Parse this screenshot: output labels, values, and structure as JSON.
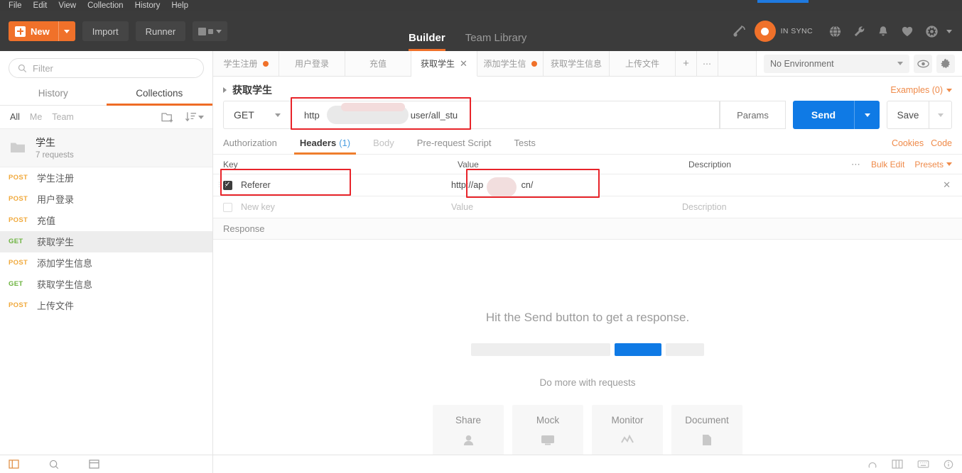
{
  "menubar": {
    "items": [
      "File",
      "Edit",
      "View",
      "Collection",
      "History",
      "Help"
    ]
  },
  "topnav": {
    "new_label": "New",
    "import_label": "Import",
    "runner_label": "Runner",
    "tabs": [
      {
        "label": "Builder",
        "active": true
      },
      {
        "label": "Team Library",
        "active": false
      }
    ],
    "sync_label": "IN SYNC",
    "icons": [
      "broadcast-icon",
      "sync-status-icon",
      "globe-icon",
      "wrench-icon",
      "bell-icon",
      "heart-icon",
      "gear-icon",
      "chevron-down-icon"
    ]
  },
  "sidebar": {
    "filter_placeholder": "Filter",
    "tabs": [
      {
        "label": "History",
        "active": false
      },
      {
        "label": "Collections",
        "active": true
      }
    ],
    "scope_filters": [
      {
        "label": "All",
        "active": true
      },
      {
        "label": "Me",
        "active": false
      },
      {
        "label": "Team",
        "active": false
      }
    ],
    "collection": {
      "name": "学生",
      "count_label": "7 requests"
    },
    "requests": [
      {
        "method": "POST",
        "name": "学生注册",
        "selected": false
      },
      {
        "method": "POST",
        "name": "用户登录",
        "selected": false
      },
      {
        "method": "POST",
        "name": "充值",
        "selected": false
      },
      {
        "method": "GET",
        "name": "获取学生",
        "selected": true
      },
      {
        "method": "POST",
        "name": "添加学生信息",
        "selected": false
      },
      {
        "method": "GET",
        "name": "获取学生信息",
        "selected": false
      },
      {
        "method": "POST",
        "name": "上传文件",
        "selected": false
      }
    ]
  },
  "main": {
    "tabs": [
      {
        "label": "学生注册",
        "dirty": true,
        "active": false,
        "closable": false
      },
      {
        "label": "用户登录",
        "dirty": false,
        "active": false,
        "closable": false
      },
      {
        "label": "充值",
        "dirty": false,
        "active": false,
        "closable": false
      },
      {
        "label": "获取学生",
        "dirty": false,
        "active": true,
        "closable": true
      },
      {
        "label": "添加学生信",
        "dirty": true,
        "active": false,
        "closable": false
      },
      {
        "label": "获取学生信息",
        "dirty": false,
        "active": false,
        "closable": false
      },
      {
        "label": "上传文件",
        "dirty": false,
        "active": false,
        "closable": false
      }
    ],
    "tab_add_label": "+",
    "tab_more_label": "•••",
    "environment": {
      "selected": "No Environment",
      "eye_icon": "eye-icon",
      "gear_icon": "gear-icon"
    },
    "request_title": "获取学生",
    "examples_label": "Examples (0)",
    "url_bar": {
      "method": "GET",
      "url_prefix": "http",
      "url_suffix": "user/all_stu",
      "params_label": "Params",
      "send_label": "Send",
      "save_label": "Save"
    },
    "request_tabs": [
      {
        "label": "Authorization",
        "active": false,
        "muted": false
      },
      {
        "label": "Headers",
        "count": "(1)",
        "active": true,
        "muted": false
      },
      {
        "label": "Body",
        "active": false,
        "muted": true
      },
      {
        "label": "Pre-request Script",
        "active": false,
        "muted": false
      },
      {
        "label": "Tests",
        "active": false,
        "muted": false
      }
    ],
    "cookies_label": "Cookies",
    "code_label": "Code",
    "headers_table": {
      "columns": [
        "Key",
        "Value",
        "Description"
      ],
      "bulk_edit_label": "Bulk Edit",
      "presets_label": "Presets",
      "rows": [
        {
          "checked": true,
          "key": "Referer",
          "value_prefix": "http://ap",
          "value_suffix": "cn/",
          "description": ""
        }
      ],
      "new_row": {
        "key_placeholder": "New key",
        "value_placeholder": "Value",
        "description_placeholder": "Description"
      }
    },
    "response": {
      "header_label": "Response",
      "empty_title": "Hit the Send button to get a response.",
      "empty_subtitle": "Do more with requests",
      "cards": [
        {
          "label": "Share",
          "icon": "share-icon"
        },
        {
          "label": "Mock",
          "icon": "mock-icon"
        },
        {
          "label": "Monitor",
          "icon": "monitor-icon"
        },
        {
          "label": "Document",
          "icon": "document-icon"
        }
      ]
    }
  },
  "statusbar": {
    "left_icons": [
      "sidebar-toggle-icon",
      "search-icon",
      "console-icon"
    ],
    "right_icons": [
      "help-icon",
      "layout-icon",
      "keyboard-icon",
      "info-icon"
    ]
  },
  "colors": {
    "accent_orange": "#f0712a",
    "send_blue": "#0f7ae5",
    "annotation_red": "#e8242a",
    "get_green": "#6cb33f",
    "post_yellow": "#f0a93c",
    "dark_chrome": "#3b3b3b"
  }
}
